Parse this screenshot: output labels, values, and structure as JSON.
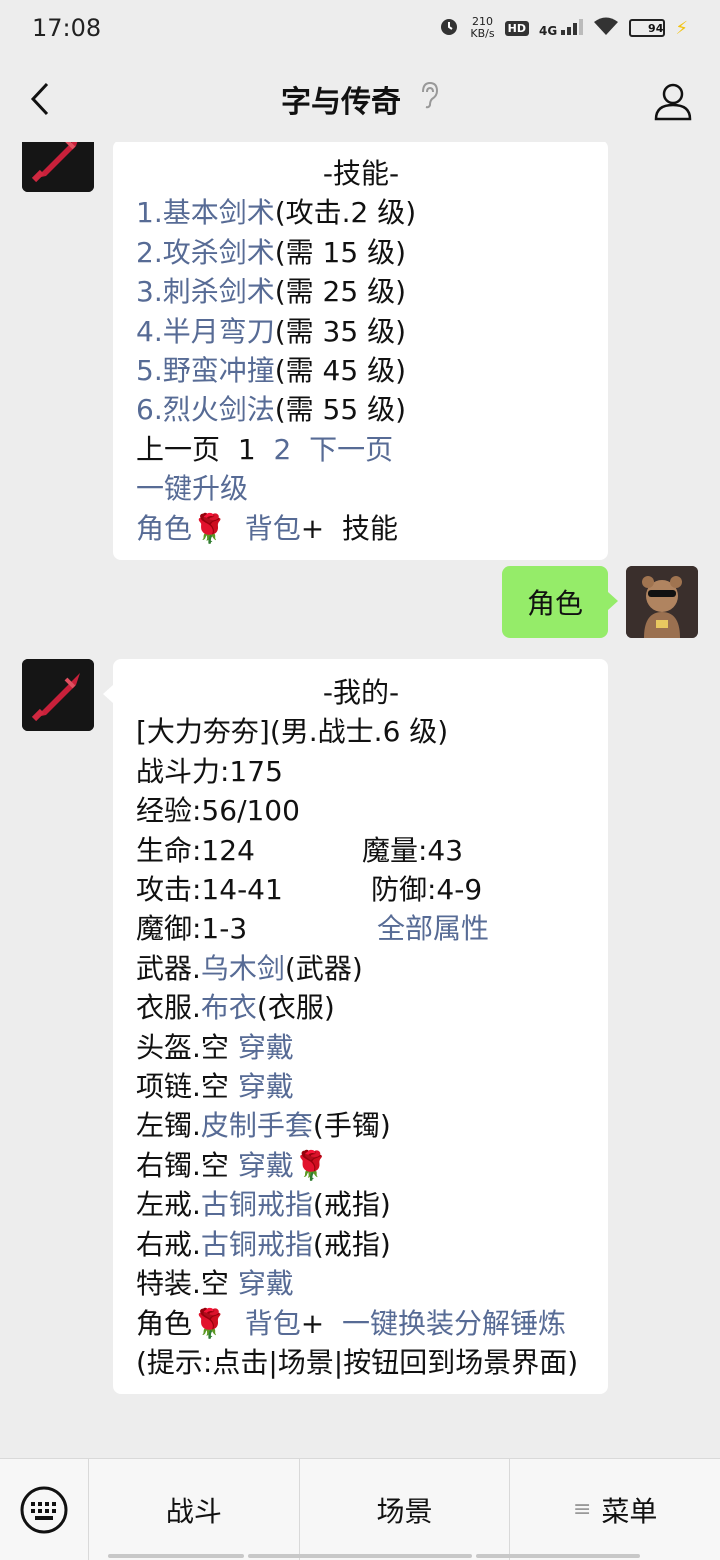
{
  "status_bar": {
    "time": "17:08",
    "net_speed_value": "210",
    "net_speed_unit": "KB/s",
    "hd": "HD",
    "signal": "4G",
    "battery": "94"
  },
  "header": {
    "title": "字与传奇"
  },
  "messages": {
    "skills": {
      "heading": "-技能-",
      "items": [
        {
          "name": "1.基本剑术",
          "suffix": "(攻击.2 级)"
        },
        {
          "name": "2.攻杀剑术",
          "suffix": "(需 15 级)"
        },
        {
          "name": "3.刺杀剑术",
          "suffix": "(需 25 级)"
        },
        {
          "name": "4.半月弯刀",
          "suffix": "(需 35 级)"
        },
        {
          "name": "5.野蛮冲撞",
          "suffix": "(需 45 级)"
        },
        {
          "name": "6.烈火剑法",
          "suffix": "(需 55 级)"
        }
      ],
      "prev_page": "上一页",
      "page_current": "1",
      "page_next_num": "2",
      "next_page": "下一页",
      "upgrade_all": "一键升级",
      "nav_role": "角色",
      "nav_bag": "背包",
      "plus": "+",
      "nav_skill": "技能",
      "rose": "🌹"
    },
    "user_msg": "角色",
    "profile": {
      "heading": "-我的-",
      "char_line": "[大力夯夯](男.战士.6 级)",
      "power": "战斗力:175",
      "exp": "经验:56/100",
      "hp": "生命:124",
      "mp": "魔量:43",
      "atk": "攻击:14-41",
      "def": "防御:4-9",
      "mdef": "魔御:1-3",
      "all_attr": "全部属性",
      "slots": [
        {
          "label": "武器.",
          "item": "乌木剑",
          "type": "(武器)",
          "action": ""
        },
        {
          "label": "衣服.",
          "item": "布衣",
          "type": "(衣服)",
          "action": ""
        },
        {
          "label": "头盔.空 ",
          "item": "",
          "type": "",
          "action": "穿戴"
        },
        {
          "label": "项链.空 ",
          "item": "",
          "type": "",
          "action": "穿戴"
        },
        {
          "label": "左镯.",
          "item": "皮制手套",
          "type": "(手镯)",
          "action": ""
        },
        {
          "label": "右镯.空 ",
          "item": "",
          "type": "",
          "action": "穿戴"
        },
        {
          "label": "左戒.",
          "item": "古铜戒指",
          "type": "(戒指)",
          "action": ""
        },
        {
          "label": "右戒.",
          "item": "古铜戒指",
          "type": "(戒指)",
          "action": ""
        },
        {
          "label": "特装.空 ",
          "item": "",
          "type": "",
          "action": "穿戴"
        }
      ],
      "nav_role": "角色",
      "nav_bag": "背包",
      "plus": "+",
      "actions": "一键换装分解锤炼",
      "hint": "(提示:点击|场景|按钮回到场景界面)",
      "rose": "🌹"
    }
  },
  "bottom_bar": {
    "tabs": [
      "战斗",
      "场景",
      "菜单"
    ]
  },
  "colors": {
    "link": "#576b95",
    "bubble_self": "#95ec69",
    "background": "#ededed"
  },
  "icons": [
    "back-arrow-icon",
    "ear-icon",
    "person-icon",
    "keyboard-icon",
    "sword-icon",
    "rose-icon"
  ]
}
